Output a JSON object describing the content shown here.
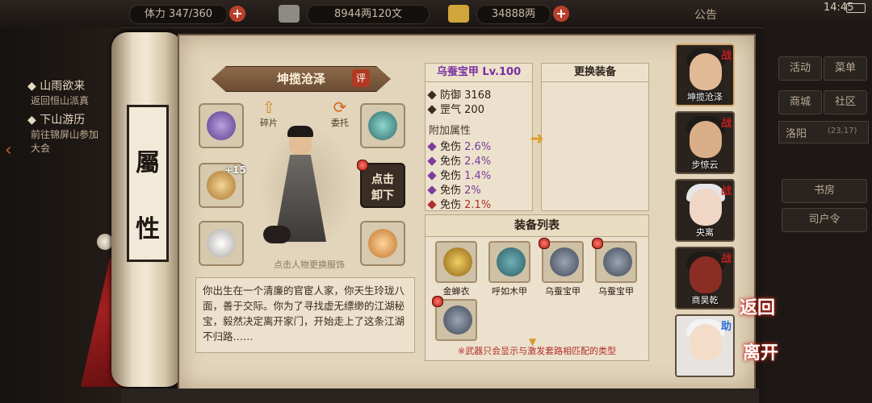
{
  "topbar": {
    "stamina": "体力 347/360",
    "silver": "8944两120文",
    "gold": "34888两",
    "notice": "公告",
    "clock": "14:45"
  },
  "quests": [
    {
      "title": "山雨欲来",
      "sub": "返回恒山派真"
    },
    {
      "title": "下山游历",
      "sub": "前往锦屏山参加",
      "sub2": "大会"
    }
  ],
  "scroll_label": {
    "char1": "屬",
    "char2": "性"
  },
  "character": {
    "name": "坤揽沧泽",
    "rate_badge": "评",
    "fragment_label": "碎片",
    "entrust_label": "委托",
    "unequip_line1": "点击",
    "unequip_line2": "卸下",
    "hint": "点击人物更换服饰",
    "enhance": "+15",
    "bio": "你出生在一个清廉的官宦人家，你天生玲珑八面，善于交际。你为了寻找虚无缥缈的江湖秘宝，毅然决定离开家门，开始走上了这条江湖不归路……"
  },
  "armor": {
    "title": "乌蚕宝甲 Lv.100",
    "base_stats": [
      {
        "label": "防御",
        "value": "3168"
      },
      {
        "label": "罡气",
        "value": "200"
      }
    ],
    "extra_title": "附加属性",
    "extra_stats": [
      {
        "label": "免伤",
        "value": "2.6%",
        "color": "purple"
      },
      {
        "label": "免伤",
        "value": "2.4%",
        "color": "purple"
      },
      {
        "label": "免伤",
        "value": "1.4%",
        "color": "purple"
      },
      {
        "label": "免伤",
        "value": "2%",
        "color": "purple"
      },
      {
        "label": "免伤",
        "value": "2.1%",
        "color": "red"
      }
    ]
  },
  "swap_panel": {
    "title": "更换装备"
  },
  "equip_list": {
    "title": "装备列表",
    "items": [
      {
        "name": "金蝉衣"
      },
      {
        "name": "呼如木甲"
      },
      {
        "name": "乌蚕宝甲"
      },
      {
        "name": "乌蚕宝甲"
      },
      {
        "name": ""
      }
    ],
    "footer": "※武器只会显示与激发套路相匹配的类型"
  },
  "team": [
    {
      "name": "坤揽沧泽",
      "tag": "战"
    },
    {
      "name": "步惊云",
      "tag": "战"
    },
    {
      "name": "央离",
      "tag": "战"
    },
    {
      "name": "商昊乾",
      "tag": "战"
    },
    {
      "name": "",
      "tag": "助"
    }
  ],
  "right_menu": {
    "activity": "活动",
    "menu": "菜单",
    "shop": "商城",
    "community": "社区",
    "city": "洛阳",
    "coords": "(23,17)",
    "study": "书房",
    "command": "司户令"
  },
  "actions": {
    "back": "返回",
    "leave": "离开"
  },
  "colors": {
    "accent_red": "#b8402c",
    "purple": "#7a3d9b",
    "red": "#b22d2d"
  }
}
